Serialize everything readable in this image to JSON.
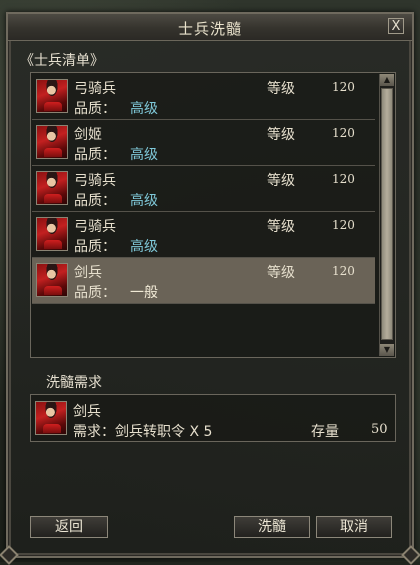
{
  "window": {
    "title": "士兵洗髓",
    "close_label": "X"
  },
  "soldier_list": {
    "heading": "《士兵清单》",
    "level_label": "等级",
    "quality_label": "品质：",
    "items": [
      {
        "name": "弓骑兵",
        "quality": "高级",
        "level": "120",
        "selected": false
      },
      {
        "name": "剑姬",
        "quality": "高级",
        "level": "120",
        "selected": false
      },
      {
        "name": "弓骑兵",
        "quality": "高级",
        "level": "120",
        "selected": false
      },
      {
        "name": "弓骑兵",
        "quality": "高级",
        "level": "120",
        "selected": false
      },
      {
        "name": "剑兵",
        "quality": "一般",
        "level": "120",
        "selected": true
      }
    ]
  },
  "requirement": {
    "heading": "洗髓需求",
    "unit_name": "剑兵",
    "text": "需求：剑兵转职令 X 5",
    "stock_label": "存量",
    "stock_value": "50"
  },
  "buttons": {
    "back": "返回",
    "refine": "洗髓",
    "cancel": "取消"
  },
  "colors": {
    "quality_high": "#7fc8d8",
    "quality_normal": "#f1ead6",
    "selected_row": "#6a6357"
  }
}
